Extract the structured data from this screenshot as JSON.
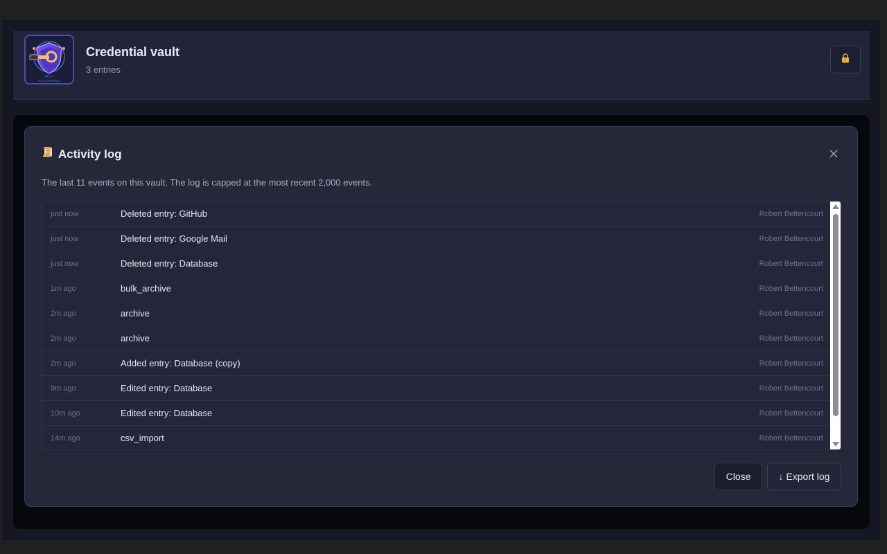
{
  "header": {
    "title": "Credential vault",
    "subtitle": "3 entries",
    "logo_text": "VAULT",
    "logo_tagline": "FOR COMPLIANCE",
    "lock_icon": "lock-icon"
  },
  "modal": {
    "icon": "scroll-icon",
    "title": "Activity log",
    "description": "The last 11 events on this vault. The log is capped at the most recent 2,000 events.",
    "close_icon": "close-icon",
    "close_label": "Close",
    "export_label": "↓ Export log"
  },
  "log": [
    {
      "time": "just now",
      "action": "Deleted entry: GitHub",
      "user": "Robert Bettencourt"
    },
    {
      "time": "just now",
      "action": "Deleted entry: Google Mail",
      "user": "Robert Bettencourt"
    },
    {
      "time": "just now",
      "action": "Deleted entry: Database",
      "user": "Robert Bettencourt"
    },
    {
      "time": "1m ago",
      "action": "bulk_archive",
      "user": "Robert Bettencourt"
    },
    {
      "time": "2m ago",
      "action": "archive",
      "user": "Robert Bettencourt"
    },
    {
      "time": "2m ago",
      "action": "archive",
      "user": "Robert Bettencourt"
    },
    {
      "time": "2m ago",
      "action": "Added entry: Database (copy)",
      "user": "Robert Bettencourt"
    },
    {
      "time": "9m ago",
      "action": "Edited entry: Database",
      "user": "Robert Bettencourt"
    },
    {
      "time": "10m ago",
      "action": "Edited entry: Database",
      "user": "Robert Bettencourt"
    },
    {
      "time": "14m ago",
      "action": "csv_import",
      "user": "Robert Bettencourt"
    }
  ]
}
